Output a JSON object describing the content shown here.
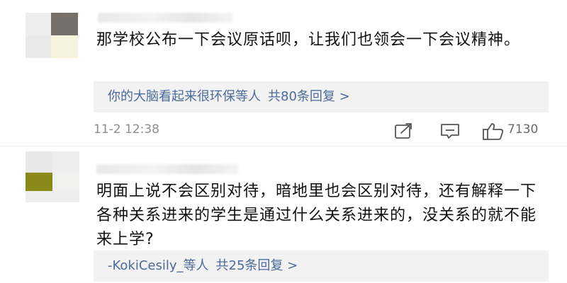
{
  "comments": [
    {
      "text": "那学校公布一下会议原话呗，让我们也领会一下会议精神。",
      "reply_summary": {
        "users": "你的大脑看起来很环保等人",
        "count_text": "共80条回复 >"
      },
      "time": "11-2 12:38",
      "like_count": "7130"
    },
    {
      "text": "明面上说不会区别对待，暗地里也会区别对待，还有解释一下各种关系进来的学生是通过什么关系进来的，没关系的就不能来上学?",
      "reply_summary": {
        "users": "-KokiCesily_等人",
        "count_text": "共25条回复 >"
      }
    }
  ],
  "icons": {
    "share": "share-icon",
    "comment": "comment-icon",
    "like": "thumbs-up-icon"
  },
  "colors": {
    "link": "#4a6a9a",
    "reply_bg": "#f2f2f2",
    "meta": "#8d8d8d"
  }
}
